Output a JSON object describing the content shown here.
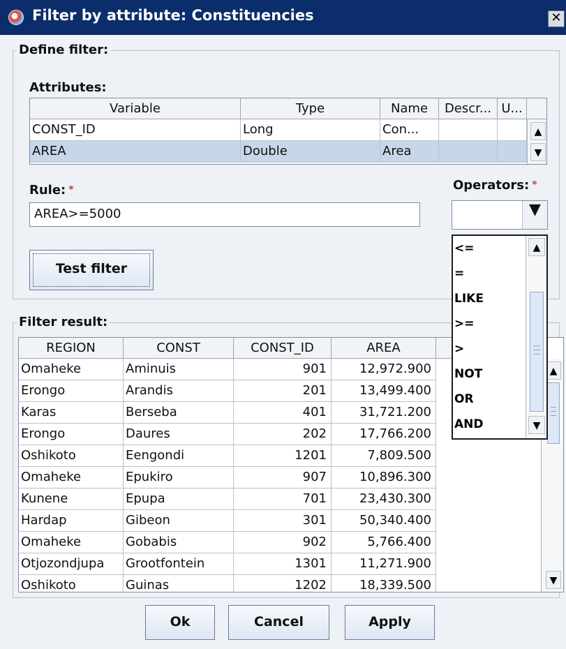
{
  "window": {
    "title": "Filter by attribute: Constituencies",
    "close_label": "✕"
  },
  "define_filter": {
    "group_label": "Define filter:",
    "attributes_label": "Attributes:",
    "attributes_table": {
      "headers": [
        "Variable",
        "Type",
        "Name",
        "Descr...",
        "U..."
      ],
      "rows": [
        [
          "CONST_ID",
          "Long",
          "Con...",
          "",
          ""
        ],
        [
          "AREA",
          "Double",
          "Area",
          "",
          ""
        ]
      ]
    },
    "rule_label": "Rule:",
    "required_marker": "*",
    "rule_value": "AREA>=5000",
    "operators_label": "Operators:",
    "operators_value": "",
    "test_filter_label": "Test filter"
  },
  "operators_dropdown": {
    "items": [
      "<=",
      "=",
      "LIKE",
      ">=",
      ">",
      "NOT",
      "OR",
      "AND"
    ]
  },
  "filter_result": {
    "group_label": "Filter result:",
    "headers": [
      "REGION",
      "CONST",
      "CONST_ID",
      "AREA"
    ],
    "rows": [
      [
        "Omaheke",
        "Aminuis",
        "901",
        "12,972.900"
      ],
      [
        "Erongo",
        "Arandis",
        "201",
        "13,499.400"
      ],
      [
        "Karas",
        "Berseba",
        "401",
        "31,721.200"
      ],
      [
        "Erongo",
        "Daures",
        "202",
        "17,766.200"
      ],
      [
        "Oshikoto",
        "Eengondi",
        "1201",
        "7,809.500"
      ],
      [
        "Omaheke",
        "Epukiro",
        "907",
        "10,896.300"
      ],
      [
        "Kunene",
        "Epupa",
        "701",
        "23,430.300"
      ],
      [
        "Hardap",
        "Gibeon",
        "301",
        "50,340.400"
      ],
      [
        "Omaheke",
        "Gobabis",
        "902",
        "5,766.400"
      ],
      [
        "Otjozondjupa",
        "Grootfontein",
        "1301",
        "11,271.900"
      ],
      [
        "Oshikoto",
        "Guinas",
        "1202",
        "18,339.500"
      ]
    ]
  },
  "buttons": {
    "ok": "Ok",
    "cancel": "Cancel",
    "apply": "Apply"
  }
}
